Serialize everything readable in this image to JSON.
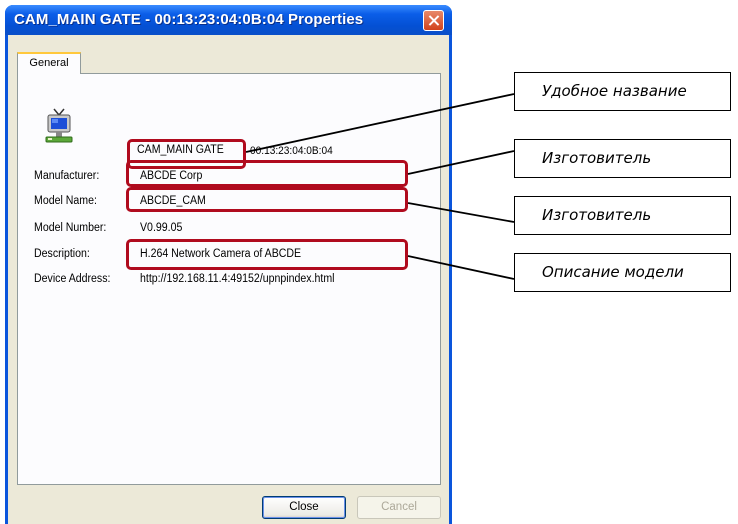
{
  "window": {
    "title": "CAM_MAIN GATE - 00:13:23:04:0B:04 Properties"
  },
  "tabs": [
    {
      "label": "General"
    }
  ],
  "device": {
    "friendly_name": "CAM_MAIN GATE",
    "mac_suffix": "00:13:23:04:0B:04",
    "icon": "network-device-icon"
  },
  "properties": [
    {
      "label": "Manufacturer:",
      "value": "ABCDE Corp"
    },
    {
      "label": "Model Name:",
      "value": "ABCDE_CAM"
    },
    {
      "label": "Model Number:",
      "value": "V0.99.05"
    },
    {
      "label": "Description:",
      "value": "H.264 Network Camera of ABCDE"
    },
    {
      "label": "Device Address:",
      "value": "http://192.168.11.4:49152/upnpindex.html"
    }
  ],
  "buttons": {
    "close": "Close",
    "cancel": "Cancel"
  },
  "annotations": [
    {
      "text": "Удобное название"
    },
    {
      "text": "Изготовитель"
    },
    {
      "text": "Изготовитель"
    },
    {
      "text": "Описание модели"
    }
  ],
  "colors": {
    "titlebar": "#0b5ee8",
    "highlight": "#b00b1e",
    "dialog_bg": "#ece9d8"
  }
}
